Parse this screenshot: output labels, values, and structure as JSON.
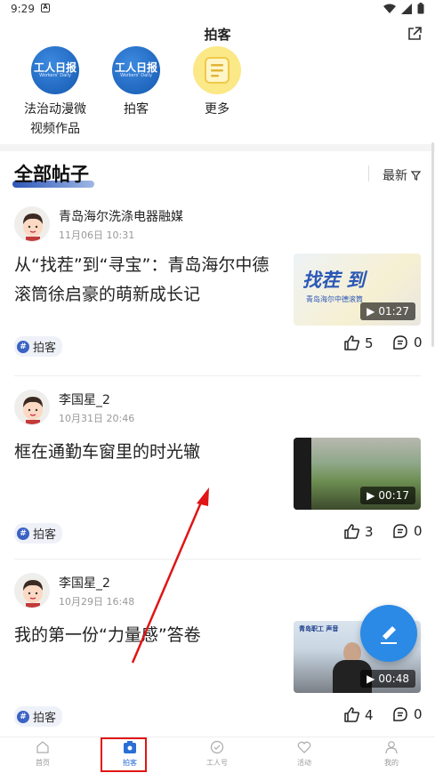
{
  "status": {
    "time": "9:29",
    "notif_icon": "A"
  },
  "header": {
    "title": "拍客"
  },
  "channels": [
    {
      "label": "法治动漫微\n视频作品",
      "logo_text": "工人日报",
      "logo_sub": "Workers' Daily"
    },
    {
      "label": "拍客",
      "logo_text": "工人日报",
      "logo_sub": "Workers' Daily"
    },
    {
      "label": "更多"
    }
  ],
  "section": {
    "title": "全部帖子",
    "sort_label": "最新"
  },
  "posts": [
    {
      "author": "青岛海尔洗涤电器融媒",
      "date": "11月06日 10:31",
      "headline": "从“找茬”到“寻宝”：青岛海尔中德滚筒徐启豪的萌新成长记",
      "thumb_text": "找茬 到",
      "thumb_sub": "青岛海尔中德滚筒",
      "duration": "01:27",
      "tag": "拍客",
      "likes": "5",
      "comments": "0"
    },
    {
      "author": "李国星_2",
      "date": "10月31日 20:46",
      "headline": "框在通勤车窗里的时光辙",
      "duration": "00:17",
      "tag": "拍客",
      "likes": "3",
      "comments": "0"
    },
    {
      "author": "李国星_2",
      "date": "10月29日 16:48",
      "headline": "我的第一份“力量感”答卷",
      "thumb_text": "青岛职工 声音",
      "duration": "00:48",
      "tag": "拍客",
      "likes": "4",
      "comments": "0"
    }
  ],
  "tabbar": [
    {
      "label": "首页"
    },
    {
      "label": "拍客"
    },
    {
      "label": "工人号"
    },
    {
      "label": "活动"
    },
    {
      "label": "我的"
    }
  ],
  "colors": {
    "accent": "#2a8ae6",
    "tab_active": "#2a6fd6",
    "highlight": "#e01515"
  }
}
